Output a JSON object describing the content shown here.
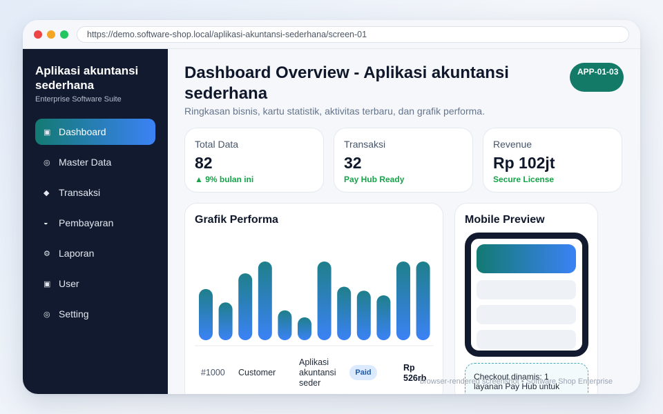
{
  "browser": {
    "url": "https://demo.software-shop.local/aplikasi-akuntansi-sederhana/screen-01"
  },
  "sidebar": {
    "title": "Aplikasi akuntansi sederhana",
    "subtitle": "Enterprise Software Suite",
    "items": [
      {
        "label": "Dashboard",
        "icon": "▣",
        "active": true
      },
      {
        "label": "Master Data",
        "icon": "◎"
      },
      {
        "label": "Transaksi",
        "icon": "◆"
      },
      {
        "label": "Pembayaran",
        "icon": "◒"
      },
      {
        "label": "Laporan",
        "icon": "⚙"
      },
      {
        "label": "User",
        "icon": "▣"
      },
      {
        "label": "Setting",
        "icon": "◎"
      }
    ]
  },
  "header": {
    "title": "Dashboard Overview - Aplikasi akuntansi sederhana",
    "subtitle": "Ringkasan bisnis, kartu statistik, aktivitas terbaru, dan grafik performa.",
    "badge": "APP-01-03"
  },
  "stats": [
    {
      "label": "Total Data",
      "value": "82",
      "note": "▲ 9% bulan ini"
    },
    {
      "label": "Transaksi",
      "value": "32",
      "note": "Pay Hub Ready"
    },
    {
      "label": "Revenue",
      "value": "Rp 102jt",
      "note": "Secure License"
    }
  ],
  "performance": {
    "title": "Grafik Performa",
    "row": {
      "id": "#1000",
      "customer": "Customer",
      "product": "Aplikasi akuntansi seder",
      "status": "Paid",
      "amount": "Rp 526rb"
    }
  },
  "chart_data": {
    "type": "bar",
    "values": [
      65,
      48,
      85,
      100,
      38,
      29,
      100,
      68,
      63,
      57,
      100,
      100
    ],
    "colors": {
      "top": "#1f7f8a",
      "bottom": "#3b82f6"
    },
    "grid": false
  },
  "mobile": {
    "title": "Mobile Preview",
    "checkout_text": "Checkout dinamis: 1 layanan Pay Hub untuk"
  },
  "footer": {
    "note": "browser-rendered screenshot • Software Shop Enterprise"
  },
  "colors": {
    "accent_start": "#137a72",
    "accent_end": "#3b82f6",
    "sidebar_bg": "#111a2e",
    "success": "#16a34a"
  }
}
